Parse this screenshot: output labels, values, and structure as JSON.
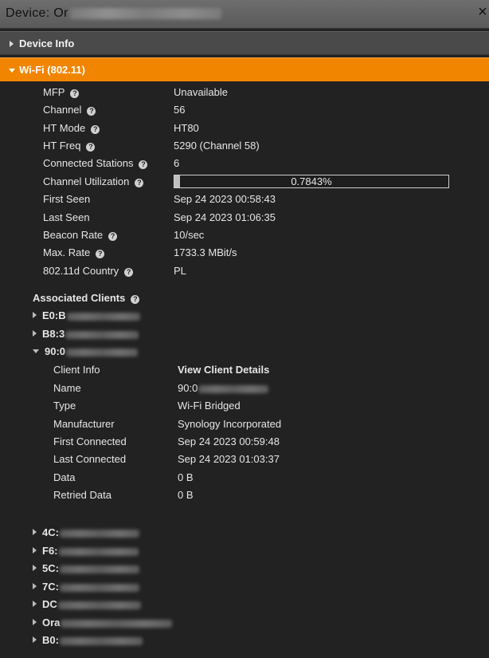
{
  "window": {
    "title": "Device: Or",
    "close_label": "×"
  },
  "sections": {
    "device_info": "Device Info",
    "wifi": "Wi-Fi (802.11)"
  },
  "wifi_fields": [
    {
      "key": "MFP",
      "value": "Unavailable"
    },
    {
      "key": "Channel",
      "value": "56"
    },
    {
      "key": "HT Mode",
      "value": "HT80"
    },
    {
      "key": "HT Freq",
      "value": "5290 (Channel 58)"
    },
    {
      "key": "Connected Stations",
      "value": "6"
    },
    {
      "key": "Channel Utilization",
      "value": "0.7843%"
    },
    {
      "key": "First Seen",
      "value": "Sep 24 2023 00:58:43"
    },
    {
      "key": "Last Seen",
      "value": "Sep 24 2023 01:06:35"
    },
    {
      "key": "Beacon Rate",
      "value": "10/sec"
    },
    {
      "key": "Max. Rate",
      "value": "1733.3 MBit/s"
    },
    {
      "key": "802.11d Country",
      "value": "PL"
    }
  ],
  "channel_utilization_fraction": 0.007843,
  "associated_clients": {
    "title": "Associated Clients",
    "clients": [
      {
        "label": "E0:B"
      },
      {
        "label": "B8:3"
      },
      {
        "label": "90:0"
      },
      {
        "label": "4C:"
      },
      {
        "label": "F6:"
      },
      {
        "label": "5C:"
      },
      {
        "label": "7C:"
      },
      {
        "label": "DC"
      },
      {
        "label": "Ora"
      },
      {
        "label": "B0:"
      }
    ],
    "expanded_client": {
      "fields": [
        {
          "key": "Client Info",
          "value": "View Client Details"
        },
        {
          "key": "Name",
          "value": "90:0"
        },
        {
          "key": "Type",
          "value": "Wi-Fi Bridged"
        },
        {
          "key": "Manufacturer",
          "value": "Synology Incorporated"
        },
        {
          "key": "First Connected",
          "value": "Sep 24 2023 00:59:48"
        },
        {
          "key": "Last Connected",
          "value": "Sep 24 2023 01:03:37"
        },
        {
          "key": "Data",
          "value": "0 B"
        },
        {
          "key": "Retried Data",
          "value": "0 B"
        }
      ]
    }
  },
  "colors": {
    "accent": "#f28500",
    "background": "#222222"
  }
}
